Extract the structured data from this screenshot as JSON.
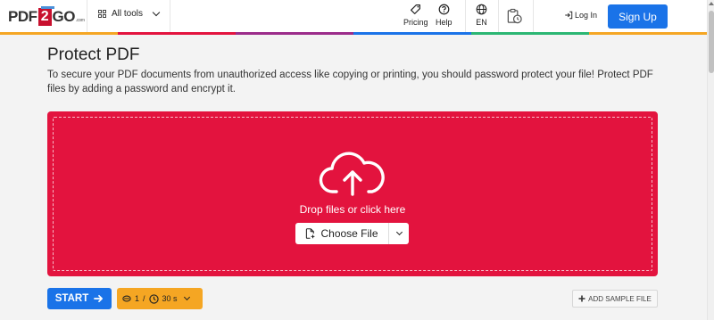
{
  "header": {
    "logo": {
      "part1": "PDF",
      "part2": "2",
      "part3": "GO",
      "suffix": ".com"
    },
    "all_tools_label": "All tools",
    "pricing_label": "Pricing",
    "help_label": "Help",
    "language_label": "EN",
    "login_label": "Log In",
    "signup_label": "Sign Up",
    "rainbow_colors": [
      "#f5a623",
      "#e3133e",
      "#9b2c8a",
      "#1a73e8",
      "#2bb673",
      "#f5a623"
    ]
  },
  "main": {
    "title": "Protect PDF",
    "description": "To secure your PDF documents from unauthorized access like copying or printing, you should password protect your file! Protect PDF files by adding a password and encrypt it.",
    "dropzone": {
      "drop_text": "Drop files or click here",
      "choose_file_label": "Choose File",
      "color": "#e3133e"
    }
  },
  "actions": {
    "start_label": "START",
    "file_limit": "1",
    "separator": "/",
    "time_limit": "30 s",
    "add_sample_label": "ADD SAMPLE FILE"
  },
  "icons": {
    "grid": "grid-icon",
    "pricing": "tag-icon",
    "help": "question-circle-icon",
    "language": "globe-icon",
    "history": "clipboard-clock-icon",
    "login": "login-arrow-icon",
    "upload": "cloud-upload-icon",
    "choose_file": "file-plus-icon",
    "start_arrow": "arrow-right-icon",
    "limit_file": "file-limit-icon",
    "limit_time": "clock-icon",
    "plus": "plus-icon"
  },
  "colors": {
    "accent_blue": "#1a73e8",
    "accent_red": "#e3133e",
    "accent_orange": "#f5a623"
  }
}
